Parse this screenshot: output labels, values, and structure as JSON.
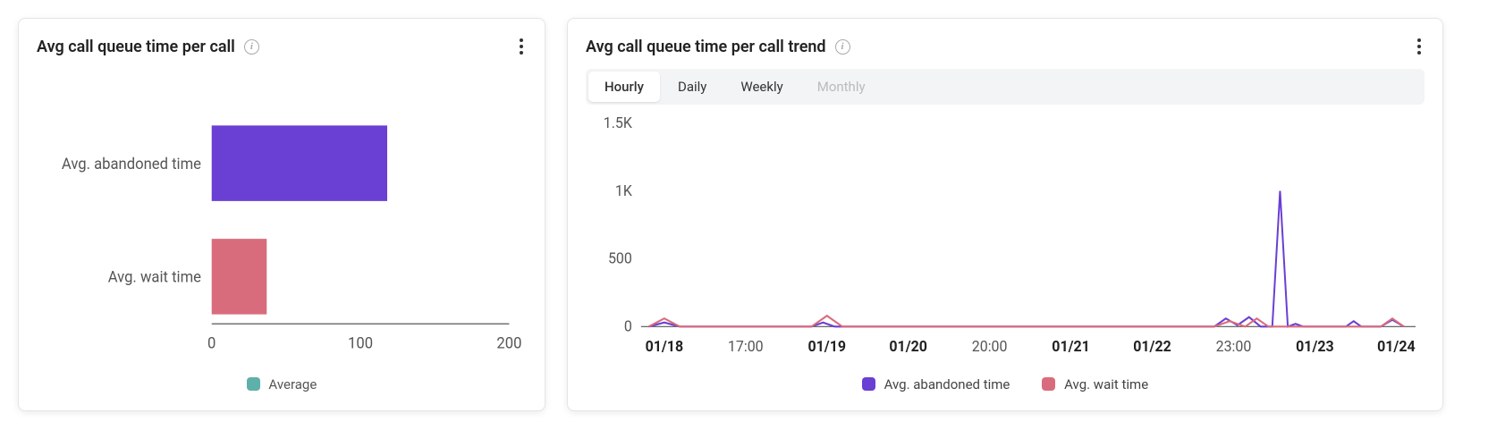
{
  "left": {
    "title": "Avg call queue time per call",
    "legend_label": "Average",
    "legend_color": "#5eb0ab"
  },
  "right": {
    "title": "Avg call queue time per call trend",
    "segments": {
      "hourly": "Hourly",
      "daily": "Daily",
      "weekly": "Weekly",
      "monthly": "Monthly"
    },
    "legend": {
      "abandoned": "Avg. abandoned time",
      "wait": "Avg. wait time"
    }
  },
  "chart_data": [
    {
      "type": "bar",
      "orientation": "horizontal",
      "title": "Avg call queue time per call",
      "categories": [
        "Avg. abandoned time",
        "Avg. wait time"
      ],
      "values": [
        118,
        37
      ],
      "xlim": [
        0,
        200
      ],
      "xticks": [
        0,
        100,
        200
      ],
      "colors": [
        "#6a3fd3",
        "#d96c7c"
      ],
      "legend": "Average",
      "legend_color": "#5eb0ab"
    },
    {
      "type": "line",
      "title": "Avg call queue time per call trend",
      "ylim": [
        0,
        1500
      ],
      "yticks": [
        0,
        500,
        1000,
        1500
      ],
      "ytick_labels": [
        "0",
        "500",
        "1K",
        "1.5K"
      ],
      "xtick_labels": [
        "01/18",
        "17:00",
        "01/19",
        "01/20",
        "20:00",
        "01/21",
        "01/22",
        "23:00",
        "01/23",
        "01/24"
      ],
      "xtick_bold": [
        true,
        false,
        true,
        true,
        false,
        true,
        true,
        false,
        true,
        true
      ],
      "x_positions": [
        0.03,
        0.135,
        0.24,
        0.345,
        0.45,
        0.555,
        0.66,
        0.765,
        0.87,
        0.975
      ],
      "series": [
        {
          "name": "Avg. abandoned time",
          "color": "#6a3fd3",
          "points": [
            {
              "x": 0.01,
              "y": 0
            },
            {
              "x": 0.03,
              "y": 30
            },
            {
              "x": 0.05,
              "y": 0
            },
            {
              "x": 0.22,
              "y": 0
            },
            {
              "x": 0.235,
              "y": 30
            },
            {
              "x": 0.25,
              "y": 0
            },
            {
              "x": 0.74,
              "y": 0
            },
            {
              "x": 0.755,
              "y": 60
            },
            {
              "x": 0.77,
              "y": 10
            },
            {
              "x": 0.785,
              "y": 70
            },
            {
              "x": 0.8,
              "y": 0
            },
            {
              "x": 0.815,
              "y": 0
            },
            {
              "x": 0.825,
              "y": 1000
            },
            {
              "x": 0.835,
              "y": 0
            },
            {
              "x": 0.845,
              "y": 20
            },
            {
              "x": 0.855,
              "y": 0
            },
            {
              "x": 0.91,
              "y": 0
            },
            {
              "x": 0.92,
              "y": 40
            },
            {
              "x": 0.93,
              "y": 0
            },
            {
              "x": 0.955,
              "y": 0
            },
            {
              "x": 0.97,
              "y": 50
            },
            {
              "x": 0.985,
              "y": 0
            }
          ]
        },
        {
          "name": "Avg. wait time",
          "color": "#d96c7c",
          "points": [
            {
              "x": 0.01,
              "y": 0
            },
            {
              "x": 0.03,
              "y": 60
            },
            {
              "x": 0.05,
              "y": 0
            },
            {
              "x": 0.22,
              "y": 0
            },
            {
              "x": 0.24,
              "y": 80
            },
            {
              "x": 0.26,
              "y": 0
            },
            {
              "x": 0.74,
              "y": 0
            },
            {
              "x": 0.76,
              "y": 40
            },
            {
              "x": 0.78,
              "y": 0
            },
            {
              "x": 0.795,
              "y": 60
            },
            {
              "x": 0.81,
              "y": 0
            },
            {
              "x": 0.955,
              "y": 0
            },
            {
              "x": 0.97,
              "y": 60
            },
            {
              "x": 0.985,
              "y": 0
            }
          ]
        }
      ]
    }
  ]
}
